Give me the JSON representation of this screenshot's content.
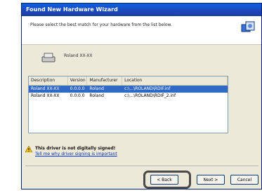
{
  "window": {
    "title": "Found New Hardware Wizard",
    "subtitle": "Please select the best match for your hardware from the list below."
  },
  "device": {
    "name": "Roland XX-XX"
  },
  "list": {
    "columns": [
      "Description",
      "Version",
      "Manufacturer",
      "Location"
    ],
    "rows": [
      {
        "description": "Roland XX-XX",
        "version": "0.0.0.0",
        "manufacturer": "Roland",
        "location": "c:\\...\\ROLAND\\RDIF.inf",
        "selected": true
      },
      {
        "description": "Roland XX-XX",
        "version": "0.0.0.0",
        "manufacturer": "Roland",
        "location": "c:\\...\\ROLAND\\RDIF_2.inf",
        "selected": false
      }
    ]
  },
  "warning": {
    "title": "This driver is not digitally signed!",
    "link": "Tell me why driver signing is important"
  },
  "buttons": {
    "back": "< Back",
    "next": "Next >",
    "cancel": "Cancel"
  },
  "colors": {
    "titlebar": "#1f47b8",
    "selection": "#316ac5",
    "window_bg": "#ece9d8"
  }
}
